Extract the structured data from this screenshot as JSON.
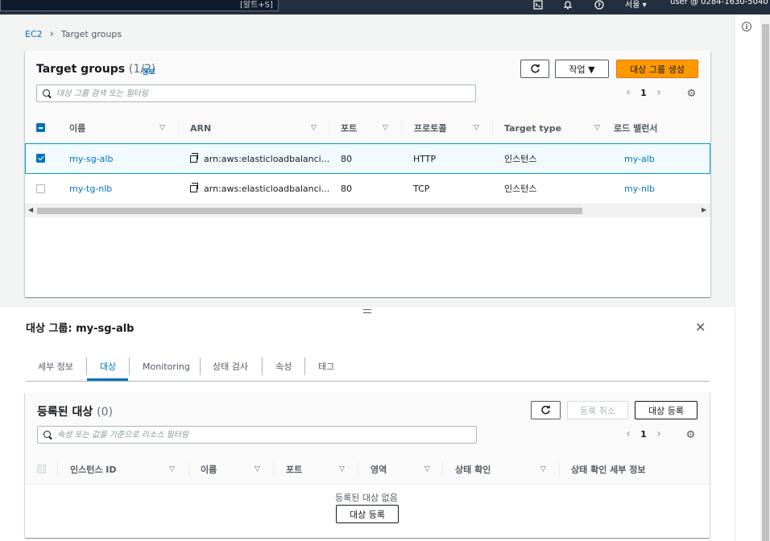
{
  "topnav": {
    "search_shortcut": "[알트+S]",
    "region": "서울 ▾",
    "account": "user @ 0284-1630-5040 ▾",
    "icons": [
      "cloudshell-icon",
      "bell-icon",
      "help-icon"
    ]
  },
  "breadcrumb": {
    "items": [
      "EC2",
      "Target groups"
    ]
  },
  "target_groups": {
    "title": "Target groups",
    "count": "(1/2)",
    "info": "정보",
    "refresh_icon": "refresh-icon",
    "actions_label": "작업 ▼",
    "create_label": "대상 그룹 생성",
    "search_placeholder": "대상 그룹 검색 또는 필터링",
    "page": "1",
    "columns": [
      "이름",
      "ARN",
      "포트",
      "프로토콜",
      "Target type",
      "로드 밸런서"
    ],
    "rows": [
      {
        "name": "my-sg-alb",
        "arn": "arn:aws:elasticloadbalanci...",
        "port": "80",
        "protocol": "HTTP",
        "target_type": "인스턴스",
        "lb": "my-alb",
        "selected": true
      },
      {
        "name": "my-tg-nlb",
        "arn": "arn:aws:elasticloadbalanci...",
        "port": "80",
        "protocol": "TCP",
        "target_type": "인스턴스",
        "lb": "my-nlb",
        "selected": false
      }
    ]
  },
  "detail": {
    "title": "대상 그룹: my-sg-alb",
    "tabs": [
      "세부 정보",
      "대상",
      "Monitoring",
      "상태 검사",
      "속성",
      "태그"
    ],
    "active_tab": "대상"
  },
  "registered": {
    "title": "등록된 대상",
    "count": "(0)",
    "deregister_label": "등록 취소",
    "register_label": "대상 등록",
    "search_placeholder": "속성 또는 값을 기준으로 리소스 필터링",
    "page": "1",
    "columns": [
      "인스턴스 ID",
      "이름",
      "포트",
      "영역",
      "상태 확인",
      "상태 확인 세부 정보"
    ],
    "empty_text": "등록된 대상 없음",
    "empty_button": "대상 등록"
  },
  "colors": {
    "primary": "#ff9900",
    "link": "#0073bb",
    "nav": "#232f3e"
  }
}
